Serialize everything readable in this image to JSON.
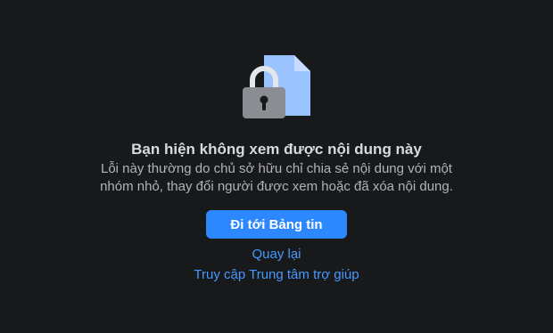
{
  "icon": {
    "name": "locked-document-icon",
    "document_color": "#99c2ff",
    "document_fold_color": "#c7ddff",
    "lock_body_color": "#8a8d91",
    "lock_shackle_color": "#e4e6eb",
    "keyhole_color": "#18191a"
  },
  "error": {
    "title": "Bạn hiện không xem được nội dung này",
    "description": "Lỗi này thường do chủ sở hữu chỉ chia sẻ nội dung với một nhóm nhỏ, thay đổi người được xem hoặc đã xóa nội dung."
  },
  "actions": {
    "primary_label": "Đi tới Bảng tin",
    "back_label": "Quay lại",
    "help_label": "Truy cập Trung tâm trợ giúp"
  },
  "colors": {
    "background": "#18191a",
    "accent": "#2d88ff",
    "link": "#4599ff"
  }
}
